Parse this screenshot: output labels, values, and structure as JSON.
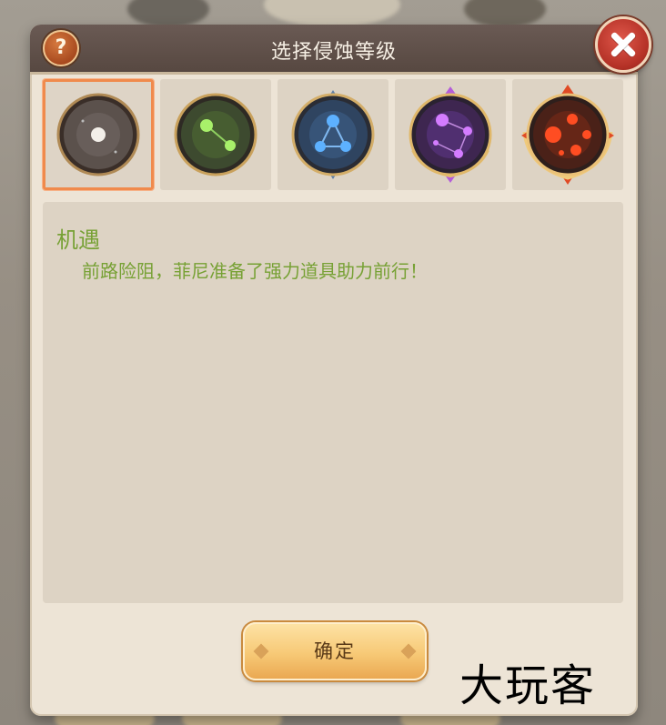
{
  "dialog": {
    "title": "选择侵蚀等级",
    "help_label": "?",
    "confirm_label": "确定"
  },
  "levels": [
    {
      "name": "level-1",
      "color": "#9a9590",
      "selected": true
    },
    {
      "name": "level-2",
      "color": "#7ec04a",
      "selected": false
    },
    {
      "name": "level-3",
      "color": "#4a90d8",
      "selected": false
    },
    {
      "name": "level-4",
      "color": "#a24bd3",
      "selected": false
    },
    {
      "name": "level-5",
      "color": "#e24f2a",
      "selected": false
    }
  ],
  "description": {
    "title": "机遇",
    "text": "前路险阻，菲尼准备了强力道具助力前行！"
  },
  "watermark": "大玩客",
  "colors": {
    "accent_text": "#77a135",
    "selected_border": "#f08a4c"
  }
}
